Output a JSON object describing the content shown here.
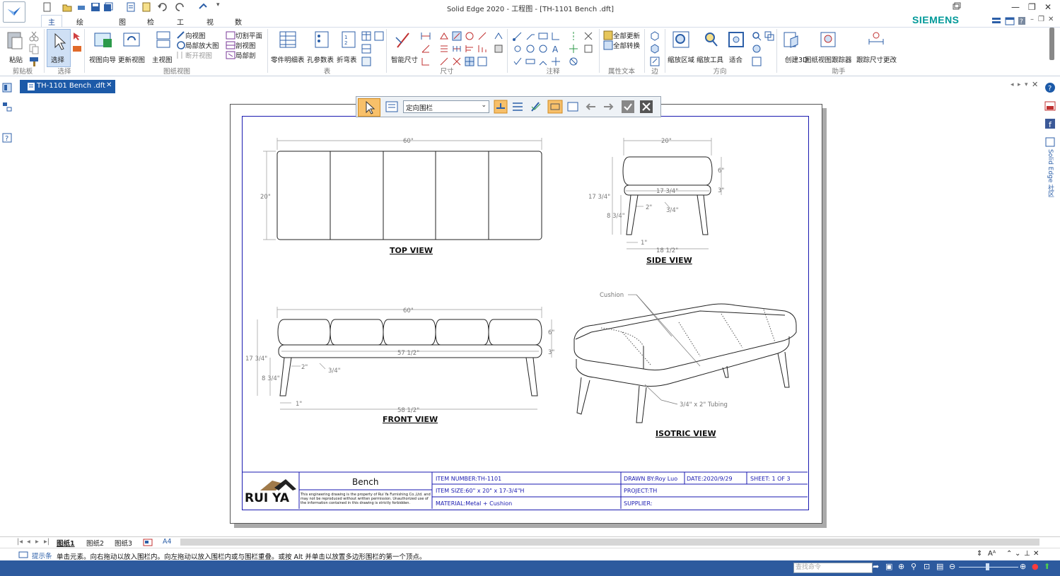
{
  "window": {
    "title": "Solid Edge 2020 - 工程图 - [TH-1101 Bench .dft]",
    "brand": "SIEMENS"
  },
  "menu_tabs": [
    "主页",
    "绘制草图",
    "图表",
    "检查",
    "工具",
    "视图",
    "数据管理"
  ],
  "ribbon": {
    "clipboard": {
      "paste": "粘贴",
      "group": "剪贴板"
    },
    "select": {
      "label": "选择",
      "group": "选择"
    },
    "drawing_views": {
      "view_wizard": "视图向导",
      "update_views": "更新视图",
      "principal": "主视图",
      "auxiliary": "向视图",
      "detail": "局部放大图",
      "broken": "断开视图",
      "section_plane": "切割平面",
      "section": "剖视图",
      "broken_out": "局部剖",
      "group": "图纸视图"
    },
    "tables": {
      "parts_list": "零件明细表",
      "hole_table": "孔参数表",
      "bend_table": "折弯表",
      "group": "表"
    },
    "dimension": {
      "smart": "智能尺寸",
      "group": "尺寸"
    },
    "annotation": {
      "group": "注释"
    },
    "property_text": {
      "update_all": "全部更新",
      "convert_all": "全部转换",
      "group": "属性文本"
    },
    "edge": {
      "group": "边"
    },
    "orient": {
      "zoom_area": "缩放区域",
      "zoom_tool": "缩放工具",
      "fit": "适合",
      "group": "方向"
    },
    "assistant": {
      "create_3d": "创建3D",
      "view_tracker": "图纸视图跟踪器",
      "track_dim": "跟踪尺寸更改",
      "group": "助手"
    }
  },
  "document_tab": {
    "label": "TH-1101 Bench .dft"
  },
  "fence_toolbar": {
    "select_value": "定向围栏"
  },
  "drawing": {
    "views": {
      "top": "TOP VIEW",
      "side": "SIDE VIEW",
      "front": "FRONT VIEW",
      "iso": "ISOTRIC VIEW"
    },
    "dims": {
      "top_w": "60\"",
      "top_h": "20\"",
      "side_w": "20\"",
      "side_6": "6\"",
      "side_17_34": "17 3/4\"",
      "side_3": "3\"",
      "side_inner": "17 3/4\"",
      "side_2": "2\"",
      "side_34": "3/4\"",
      "side_8_34": "8 3/4\"",
      "side_1": "1\"",
      "side_18_12": "18 1/2\"",
      "front_w": "60\"",
      "front_6": "6\"",
      "front_3": "3\"",
      "front_57_12": "57 1/2\"",
      "front_17_34": "17 3/4\"",
      "front_2": "2\"",
      "front_34": "3/4\"",
      "front_8_34": "8 3/4\"",
      "front_1": "1\"",
      "front_58_12": "58 1/2\""
    },
    "iso_notes": {
      "cushion": "Cushion",
      "tubing": "3/4\" x 2\" Tubing"
    }
  },
  "title_block": {
    "company_logo_text": "RUI YA",
    "name": "Bench",
    "notice": "This engineering drawing is the property of Rui Ya Furnishing Co.,Ltd. and may not be reproduced without written permission. Unauthorized use of the information contained in this drawing is strictly forbidden.",
    "item_number": "ITEM NUMBER:TH-1101",
    "item_size": "ITEM SIZE:60\" x 20\" x 17-3/4\"H",
    "material": "MATERIAL:Metal + Cushion",
    "drawn_by": "DRAWN BY:Roy Luo",
    "date": "DATE:2020/9/29",
    "sheet": "SHEET: 1 OF 3",
    "project": "PROJECT:TH",
    "supplier": "SUPPLIER:"
  },
  "sheet_tabs": [
    "图纸1",
    "图纸2",
    "图纸3",
    "A4"
  ],
  "prompt": {
    "label": "提示条",
    "text": "单击元素。向右拖动以放入围栏内。向左拖动以放入围栏内或与围栏重叠。或按 Alt 并单击以放置多边形围栏的第一个顶点。"
  },
  "status": {
    "find_placeholder": "查找命令"
  },
  "right_sidebar": {
    "label": "Solid Edge 社区"
  },
  "colors": {
    "status_bar": "#2d5a9e",
    "doc_tab": "#1c5aa8",
    "border": "#1a1ab0",
    "brand": "#009999"
  }
}
